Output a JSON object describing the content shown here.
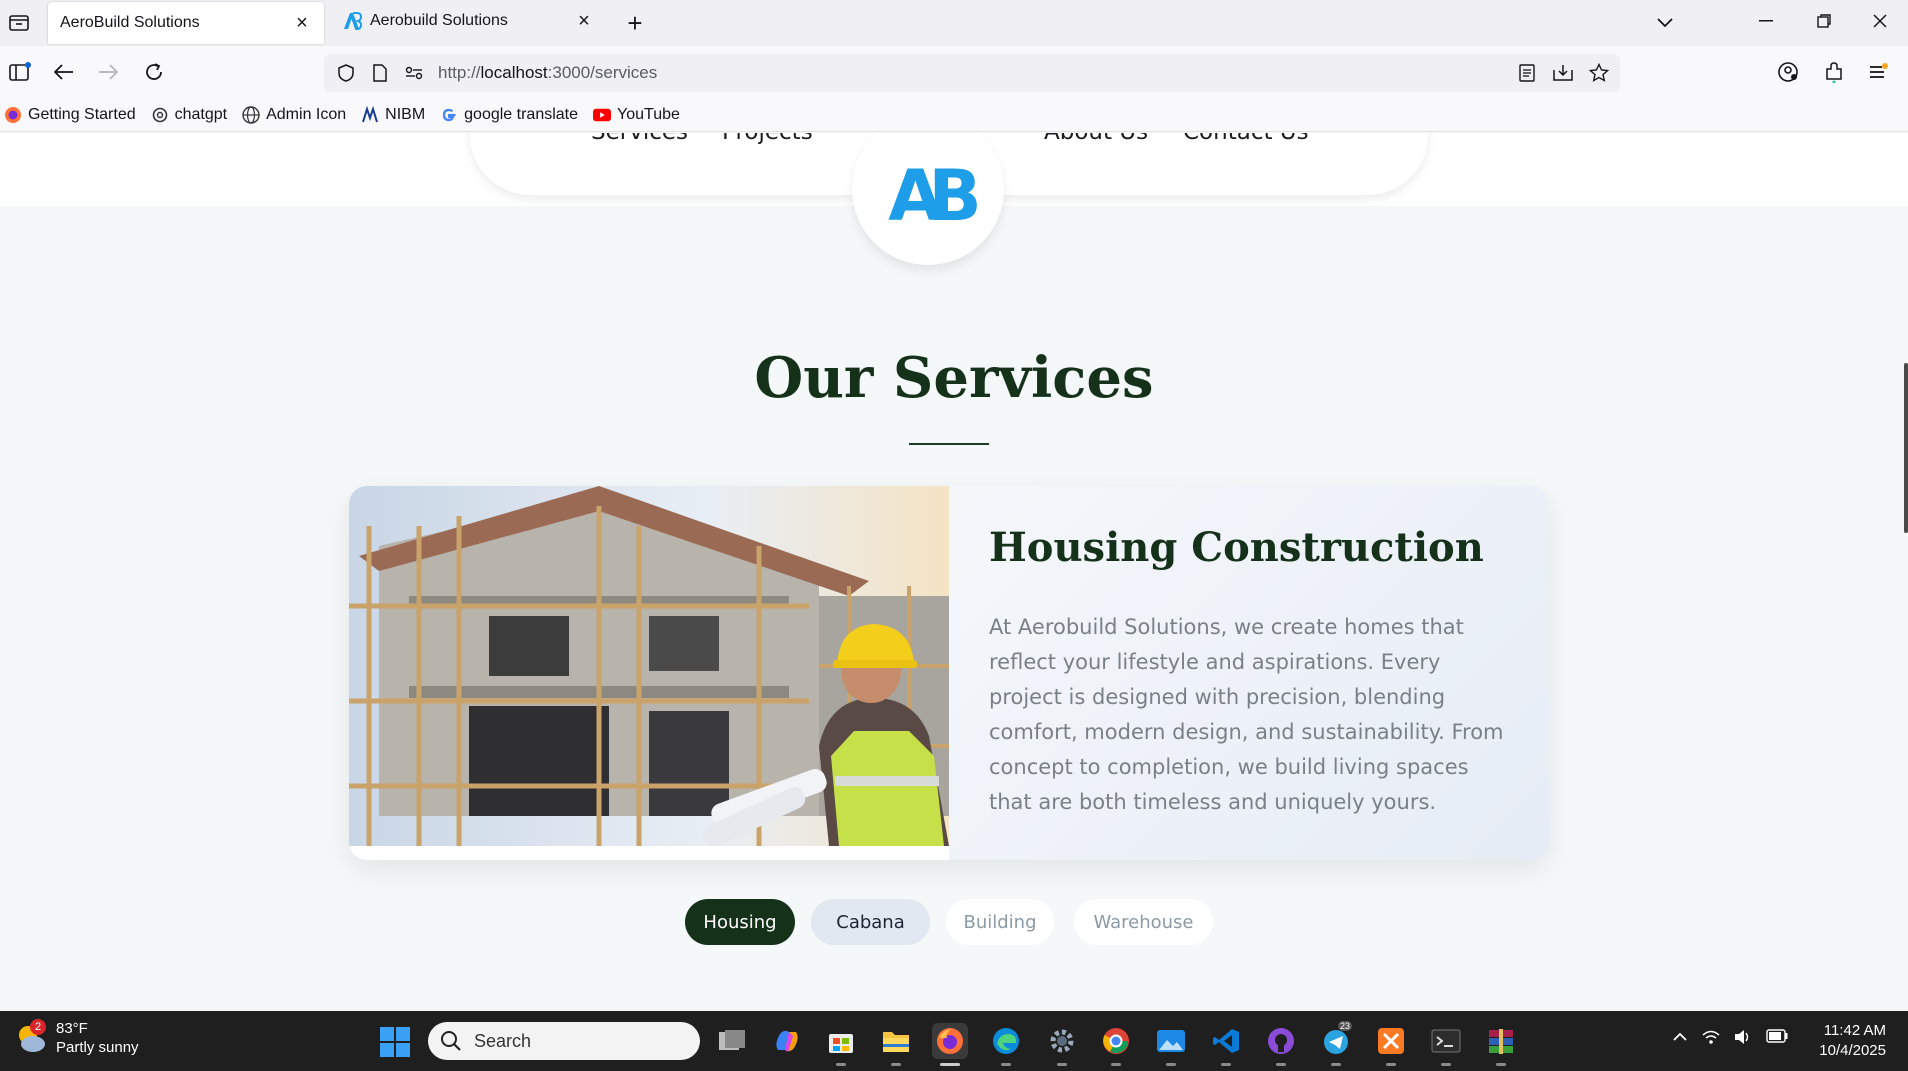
{
  "browser": {
    "tabs": [
      {
        "title": "AeroBuild Solutions",
        "active": true
      },
      {
        "title": "Aerobuild Solutions",
        "active": false
      }
    ],
    "url": {
      "scheme": "http://",
      "host": "localhost",
      "rest": ":3000/services"
    },
    "bookmarks": [
      {
        "label": "Getting Started",
        "icon": "firefox-icon"
      },
      {
        "label": "chatgpt",
        "icon": "chatgpt-icon"
      },
      {
        "label": "Admin Icon",
        "icon": "globe-icon"
      },
      {
        "label": "NIBM",
        "icon": "nibm-icon"
      },
      {
        "label": "google translate",
        "icon": "google-icon"
      },
      {
        "label": "YouTube",
        "icon": "youtube-icon"
      }
    ]
  },
  "site": {
    "nav": {
      "services": "Services",
      "projects": "Projects",
      "about": "About Us",
      "contact": "Contact Us",
      "logo": "AB"
    },
    "section_title": "Our Services",
    "card": {
      "title": "Housing Construction",
      "description": "At Aerobuild Solutions, we create homes that reflect your lifestyle and aspirations. Every project is designed with precision, blending comfort, modern design, and sustainability. From concept to completion, we build living spaces that are both timeless and uniquely yours."
    },
    "categories": [
      {
        "label": "Housing",
        "selected": true
      },
      {
        "label": "Cabana",
        "selected": false
      },
      {
        "label": "Building",
        "selected": false
      },
      {
        "label": "Warehouse",
        "selected": false
      }
    ]
  },
  "taskbar": {
    "weather": {
      "temp": "83°F",
      "condition": "Partly sunny",
      "badge": "2"
    },
    "search_placeholder": "Search",
    "time": "11:42 AM",
    "date": "10/4/2025",
    "telegram_badge": "23"
  },
  "colors": {
    "accent_green": "#15311a",
    "logo_blue": "#1e9ee8"
  }
}
